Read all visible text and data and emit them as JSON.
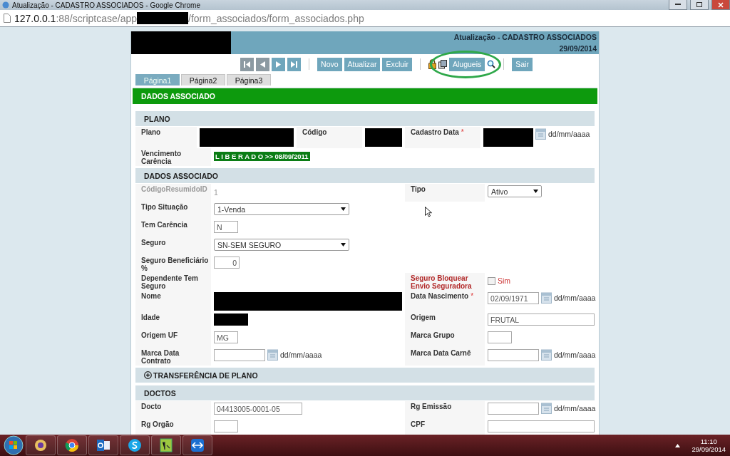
{
  "window": {
    "title": "Atualização - CADASTRO ASSOCIADOS - Google Chrome"
  },
  "address_bar": {
    "host": "127.0.0.1",
    "path_start": ":88/scriptcase/app",
    "path_end": "/form_associados/form_associados.php"
  },
  "header": {
    "title": "Atualização - CADASTRO ASSOCIADOS",
    "date": "29/09/2014"
  },
  "toolbar": {
    "actions": [
      "Novo",
      "Atualizar",
      "Excluir"
    ],
    "extra": "Alugueis",
    "exit": "Sair"
  },
  "tabs": [
    {
      "label": "Página1",
      "selected": true
    },
    {
      "label": "Página2",
      "selected": false
    },
    {
      "label": "Página3",
      "selected": false
    }
  ],
  "banner": "DADOS ASSOCIADO",
  "sections": [
    {
      "title": "PLANO",
      "rows": [
        [
          {
            "label": "Plano",
            "field": {
              "kind": "redacted"
            }
          },
          {
            "label": "Código",
            "field": {
              "kind": "redacted"
            }
          },
          {
            "label": "Cadastro Data",
            "required_mark": "*",
            "field": {
              "kind": "redacted-date",
              "format": "dd/mm/aaaa"
            }
          }
        ],
        [
          {
            "label": "Vencimento Carência",
            "field": {
              "kind": "badge",
              "value": "L I B E R A D O >> 08/09/2011"
            }
          }
        ]
      ]
    },
    {
      "title": "DADOS ASSOCIADO",
      "rows": [
        [
          {
            "label": "CódigoResumidoID",
            "disabled": true,
            "field": {
              "kind": "plain",
              "value": "1"
            }
          },
          {
            "label": "Tipo",
            "field": {
              "kind": "select",
              "value": "Ativo"
            }
          }
        ],
        [
          {
            "label": "Tipo Situação",
            "field": {
              "kind": "select",
              "value": "1-Venda"
            }
          }
        ],
        [
          {
            "label": "Tem Carência",
            "field": {
              "kind": "short-input",
              "value": "N"
            }
          }
        ],
        [
          {
            "label": "Seguro",
            "field": {
              "kind": "select",
              "value": "SN-SEM SEGURO"
            }
          }
        ],
        [
          {
            "label": "Seguro Beneficiário %",
            "field": {
              "kind": "number-input",
              "value": "0"
            }
          }
        ],
        [
          {
            "label": "Dependente Tem Seguro",
            "field": {
              "kind": "none"
            }
          },
          {
            "label": "Seguro Bloquear Envio Seguradora",
            "highlighted": true,
            "field": {
              "kind": "checkbox",
              "label": "Sim",
              "checked": false
            }
          }
        ],
        [
          {
            "label": "Nome",
            "field": {
              "kind": "redacted"
            }
          },
          {
            "label": "Data Nascimento",
            "required_mark": "*",
            "field": {
              "kind": "date",
              "value": "02/09/1971",
              "format": "dd/mm/aaaa"
            }
          }
        ],
        [
          {
            "label": "Idade",
            "field": {
              "kind": "redacted-short"
            }
          },
          {
            "label": "Origem",
            "field": {
              "kind": "input",
              "value": "FRUTAL"
            }
          }
        ],
        [
          {
            "label": "Origem UF",
            "field": {
              "kind": "short-input",
              "value": "MG"
            }
          },
          {
            "label": "Marca Grupo",
            "field": {
              "kind": "short-input"
            }
          }
        ],
        [
          {
            "label": "Marca Data Contrato",
            "field": {
              "kind": "date",
              "format": "dd/mm/aaaa"
            }
          },
          {
            "label": "Marca Data Carnê",
            "field": {
              "kind": "date",
              "format": "dd/mm/aaaa"
            }
          }
        ]
      ]
    },
    {
      "title": "TRANSFERÊNCIA DE PLANO",
      "expanded": false
    },
    {
      "title": "DOCTOS",
      "rows": [
        [
          {
            "label": "Docto",
            "field": {
              "kind": "input",
              "value": "04413005-0001-05"
            }
          },
          {
            "label": "Rg Emissão",
            "field": {
              "kind": "date",
              "format": "dd/mm/aaaa"
            }
          }
        ],
        [
          {
            "label": "Rg Orgão",
            "field": {
              "kind": "short-input"
            }
          },
          {
            "label": "CPF",
            "field": {
              "kind": "input"
            }
          }
        ]
      ]
    }
  ],
  "taskbar": {
    "time": "11:10",
    "date": "29/09/2014"
  }
}
